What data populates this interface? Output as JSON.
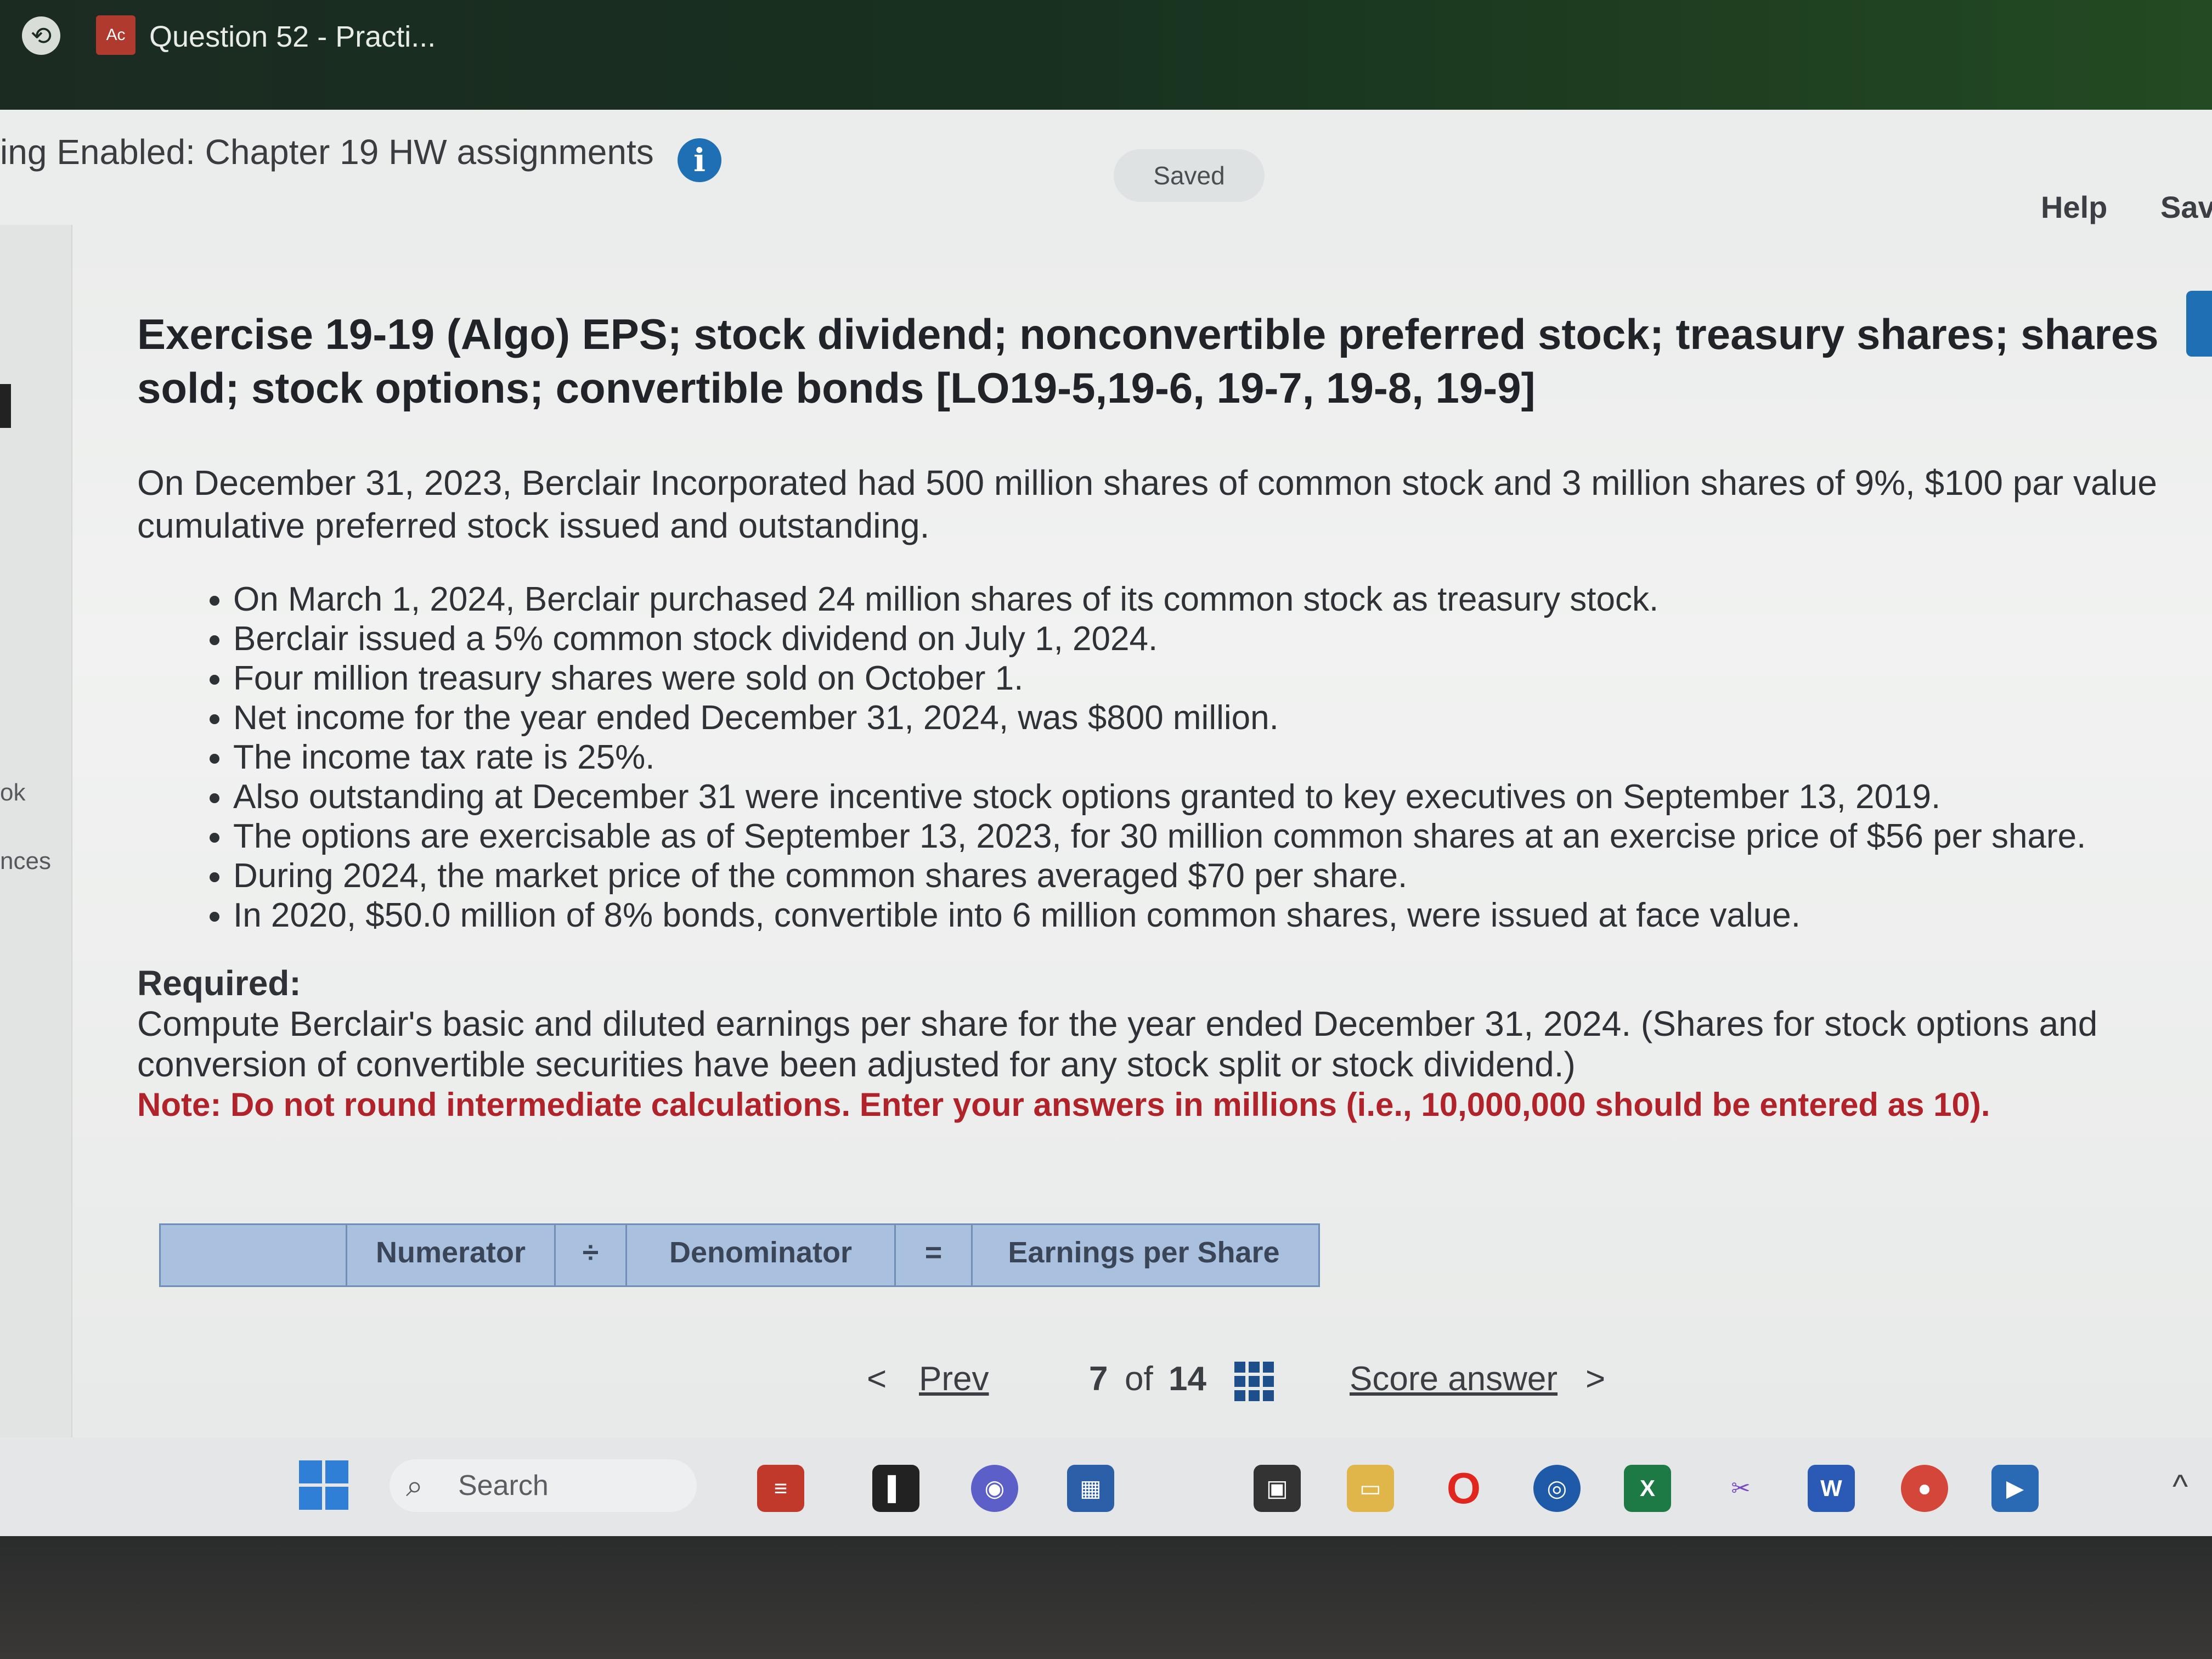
{
  "browser": {
    "tab_title": "Question 52 - Practi...",
    "favicon_text": "Ac"
  },
  "header": {
    "assignment_title": "ing Enabled: Chapter 19 HW assignments",
    "info_icon": "i",
    "saved_status": "Saved",
    "help_label": "Help",
    "save_label": "Sav"
  },
  "left_rail": {
    "label_1": "ok",
    "label_2": "nces"
  },
  "exercise": {
    "title": "Exercise 19-19 (Algo) EPS; stock dividend; nonconvertible preferred stock; treasury shares; shares sold; stock options; convertible bonds [LO19-5,19-6, 19-7, 19-8, 19-9]",
    "intro": "On December 31, 2023, Berclair Incorporated had 500 million shares of common stock and 3 million shares of 9%, $100 par value cumulative preferred stock issued and outstanding.",
    "bullets": [
      "On March 1, 2024, Berclair purchased 24 million shares of its common stock as treasury stock.",
      "Berclair issued a 5% common stock dividend on July 1, 2024.",
      "Four million treasury shares were sold on October 1.",
      "Net income for the year ended December 31, 2024, was $800 million.",
      "The income tax rate is 25%.",
      "Also outstanding at December 31 were incentive stock options granted to key executives on September 13, 2019.",
      "The options are exercisable as of September 13, 2023, for 30 million common shares at an exercise price of $56 per share.",
      "During 2024, the market price of the common shares averaged $70 per share.",
      "In 2020, $50.0 million of 8% bonds, convertible into 6 million common shares, were issued at face value."
    ],
    "required_label": "Required:",
    "required_text": "Compute Berclair's basic and diluted earnings per share for the year ended December 31, 2024. (Shares for stock options and conversion of convertible securities have been adjusted for any stock split or stock dividend.)",
    "note": "Note: Do not round intermediate calculations. Enter your answers in millions (i.e., 10,000,000 should be entered as 10)."
  },
  "table": {
    "col_blank": "",
    "col_numerator": "Numerator",
    "op_divide": "÷",
    "col_denominator": "Denominator",
    "op_equals": "=",
    "col_eps": "Earnings per Share"
  },
  "pager": {
    "prev_label": "Prev",
    "current": "7",
    "of_label": "of",
    "total": "14",
    "score_label": "Score answer"
  },
  "taskbar": {
    "search_label": "Search",
    "apps": [
      "files-icon",
      "word-icon",
      "excel-icon"
    ]
  },
  "colors": {
    "accent_blue": "#1f6fb5",
    "note_red": "#b0232a",
    "table_header": "#a9c1de"
  }
}
